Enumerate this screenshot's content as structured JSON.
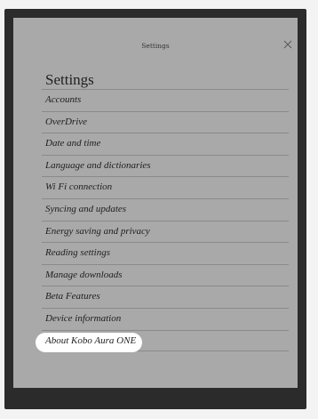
{
  "header": {
    "title": "Settings",
    "close_icon": "close-icon"
  },
  "page": {
    "title": "Settings"
  },
  "menu": {
    "items": [
      {
        "label": "Accounts"
      },
      {
        "label": "OverDrive"
      },
      {
        "label": "Date and time"
      },
      {
        "label": "Language and dictionaries"
      },
      {
        "label": "Wi Fi connection"
      },
      {
        "label": "Syncing and updates"
      },
      {
        "label": "Energy saving and privacy"
      },
      {
        "label": "Reading settings"
      },
      {
        "label": "Manage downloads"
      },
      {
        "label": "Beta Features"
      },
      {
        "label": "Device information"
      },
      {
        "label": "About Kobo Aura ONE",
        "highlighted": true
      }
    ]
  },
  "colors": {
    "screen": "#a9a9a9",
    "bezel": "#2b2b2b",
    "highlight": "#ffffff"
  }
}
